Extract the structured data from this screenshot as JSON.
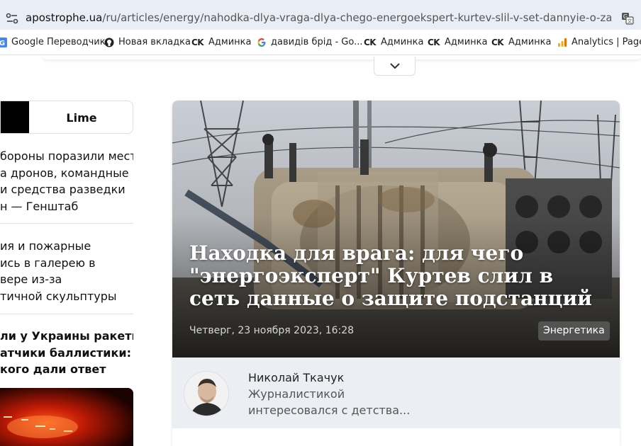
{
  "browser": {
    "url_domain": "apostrophe.ua",
    "url_path": "/ru/articles/energy/nahodka-dlya-vraga-dlya-chego-energoekspert-kurtev-slil-v-set-dannyie-o-zaschite-pod..."
  },
  "bookmarks": [
    {
      "label": "Google Переводчик",
      "icon": "google-translate-icon"
    },
    {
      "label": "Новая вкладка",
      "icon": "github-icon"
    },
    {
      "label": "Админка",
      "icon": "ck-logo-icon",
      "prefix": "CK"
    },
    {
      "label": "давидів брід - Go...",
      "icon": "google-g-icon"
    },
    {
      "label": "Админка",
      "icon": "ck-logo-icon",
      "prefix": "CK"
    },
    {
      "label": "Админка",
      "icon": "ck-logo-icon",
      "prefix": "CK"
    },
    {
      "label": "Админка",
      "icon": "ck-logo-icon",
      "prefix": "CK"
    },
    {
      "label": "Analytics | Pages",
      "icon": "analytics-icon"
    }
  ],
  "sidebar": {
    "tab_label": "Lime",
    "news": [
      {
        "lines": [
          "бороны поразили места",
          "а дронов, командные",
          "и средства разведки",
          "н — Генштаб"
        ],
        "bold": false
      },
      {
        "lines": [
          "ия и пожарные",
          "ись в галерею в",
          "вере из-за",
          "тичной скульптуры"
        ],
        "bold": false
      },
      {
        "lines": [
          "ли у Украины ракеты-",
          "атчики баллистики: у",
          "кого дали ответ"
        ],
        "bold": true
      }
    ]
  },
  "article": {
    "title": "Находка для врага: для чего \"энергоэксперт\" Куртев слил в сеть данные о защите подстанций",
    "date": "Четверг, 23 ноября 2023, 16:28",
    "tag": "Энергетика",
    "author": {
      "name": "Николай Ткачук",
      "bio_line1": "Журналистикой",
      "bio_line2": "интересовался с детства..."
    }
  },
  "colors": {
    "urlbar_bg": "#e9eef6",
    "author_bar_bg": "#ebeff4",
    "tag_bg": "#5a5a5a"
  }
}
